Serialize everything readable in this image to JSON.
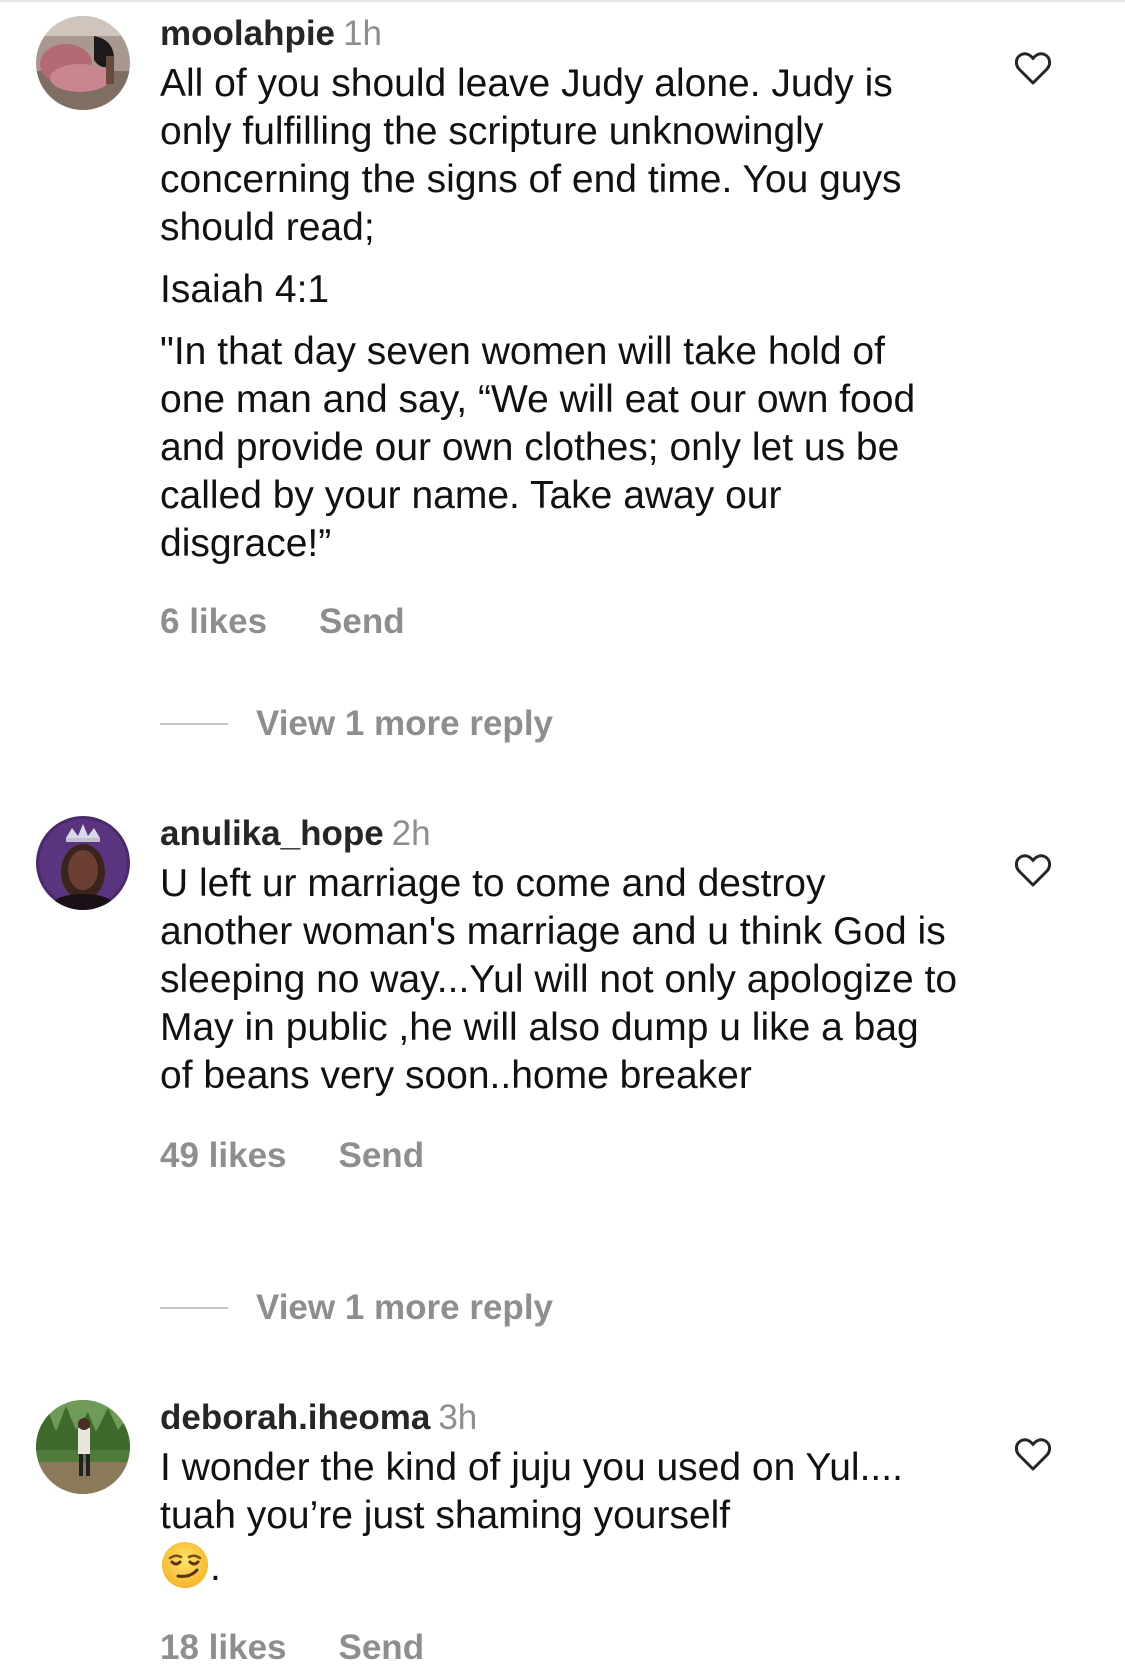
{
  "comments": [
    {
      "username": "moolahpie",
      "time": "1h",
      "paragraphs": [
        "All of you should leave Judy alone. Judy is only fulfilling the scripture unknowingly concerning the signs of end time. You guys should read;",
        "Isaiah 4:1",
        "\"In that day seven women will take hold of one man and say, “We will eat our own food and provide our own clothes; only let us be called by your name. Take away our disgrace!”"
      ],
      "likes": "6 likes",
      "send": "Send",
      "view_replies": "View 1 more reply",
      "like_icon": "heart-outline-icon"
    },
    {
      "username": "anulika_hope",
      "time": "2h",
      "paragraphs": [
        "U left ur marriage to come and destroy another woman's marriage and u think God is sleeping no way...Yul will not only apologize to May in public ,he will also dump u like a bag of beans very soon..home breaker"
      ],
      "likes": "49 likes",
      "send": "Send",
      "view_replies": "View 1 more reply",
      "like_icon": "heart-outline-icon"
    },
    {
      "username": "deborah.iheoma",
      "time": "3h",
      "text": "I wonder the kind of juju you used on Yul.... tuah you’re just shaming yourself",
      "text_after_emoji": ".",
      "emoji": "smirking-face-emoji",
      "likes": "18 likes",
      "send": "Send",
      "like_icon": "heart-outline-icon"
    }
  ],
  "colors": {
    "username": "#262626",
    "secondary": "#8e8e8e",
    "text": "#111111",
    "divider": "#c7c7c7"
  }
}
